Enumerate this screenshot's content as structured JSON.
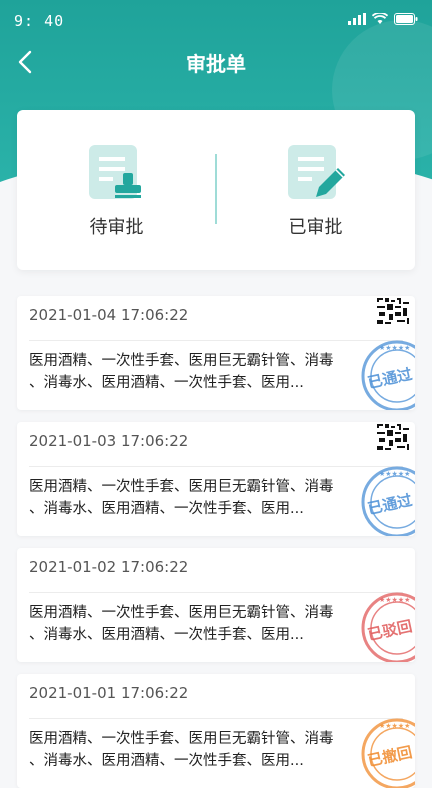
{
  "status": {
    "time": "9: 40"
  },
  "nav": {
    "title": "审批单"
  },
  "tabs": [
    {
      "label": "待审批",
      "icon": "stamp-document-icon"
    },
    {
      "label": "已审批",
      "icon": "edit-document-icon"
    }
  ],
  "records": [
    {
      "date": "2021-01-04 17:06:22",
      "line1": "医用酒精、一次性手套、医用巨无霸针管、消毒",
      "line2": "、消毒水、医用酒精、一次性手套、医用...",
      "stamp": "已通过",
      "stamp_color": "#4a8fd6"
    },
    {
      "date": "2021-01-03 17:06:22",
      "line1": "医用酒精、一次性手套、医用巨无霸针管、消毒",
      "line2": "、消毒水、医用酒精、一次性手套、医用...",
      "stamp": "已通过",
      "stamp_color": "#4a8fd6"
    },
    {
      "date": "2021-01-02 17:06:22",
      "line1": "医用酒精、一次性手套、医用巨无霸针管、消毒",
      "line2": "、消毒水、医用酒精、一次性手套、医用...",
      "stamp": "已驳回",
      "stamp_color": "#e05a5a"
    },
    {
      "date": "2021-01-01 17:06:22",
      "line1": "医用酒精、一次性手套、医用巨无霸针管、消毒",
      "line2": "、消毒水、医用酒精、一次性手套、医用...",
      "stamp": "已撤回",
      "stamp_color": "#f08a2c"
    }
  ],
  "colors": {
    "primary": "#1fa39a",
    "divider": "#9fdcd7",
    "icon_bg": "#cdebe8",
    "icon_fg": "#23a79e"
  }
}
